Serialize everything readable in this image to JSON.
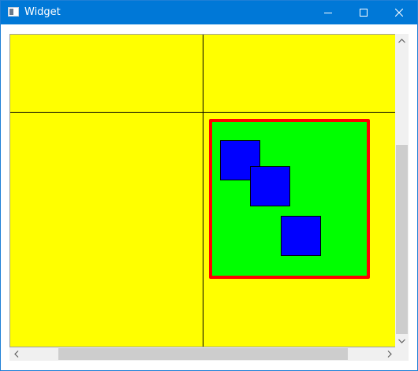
{
  "window": {
    "title": "Widget",
    "titlebar_color": "#0078d7",
    "icons": {
      "app": "app-window-icon",
      "minimize": "minimize-icon",
      "maximize": "maximize-icon",
      "close": "close-icon"
    }
  },
  "scene": {
    "background_color": "#ffff00",
    "grid_line_color": "#000000",
    "rect_fill": "#00ff00",
    "rect_border": "#ff0000",
    "square_fill": "#0000ff",
    "square_count": 3
  },
  "scrollbars": {
    "vertical": {
      "up_icon": "chevron-up-icon",
      "down_icon": "chevron-down-icon"
    },
    "horizontal": {
      "left_icon": "chevron-left-icon",
      "right_icon": "chevron-right-icon"
    }
  }
}
